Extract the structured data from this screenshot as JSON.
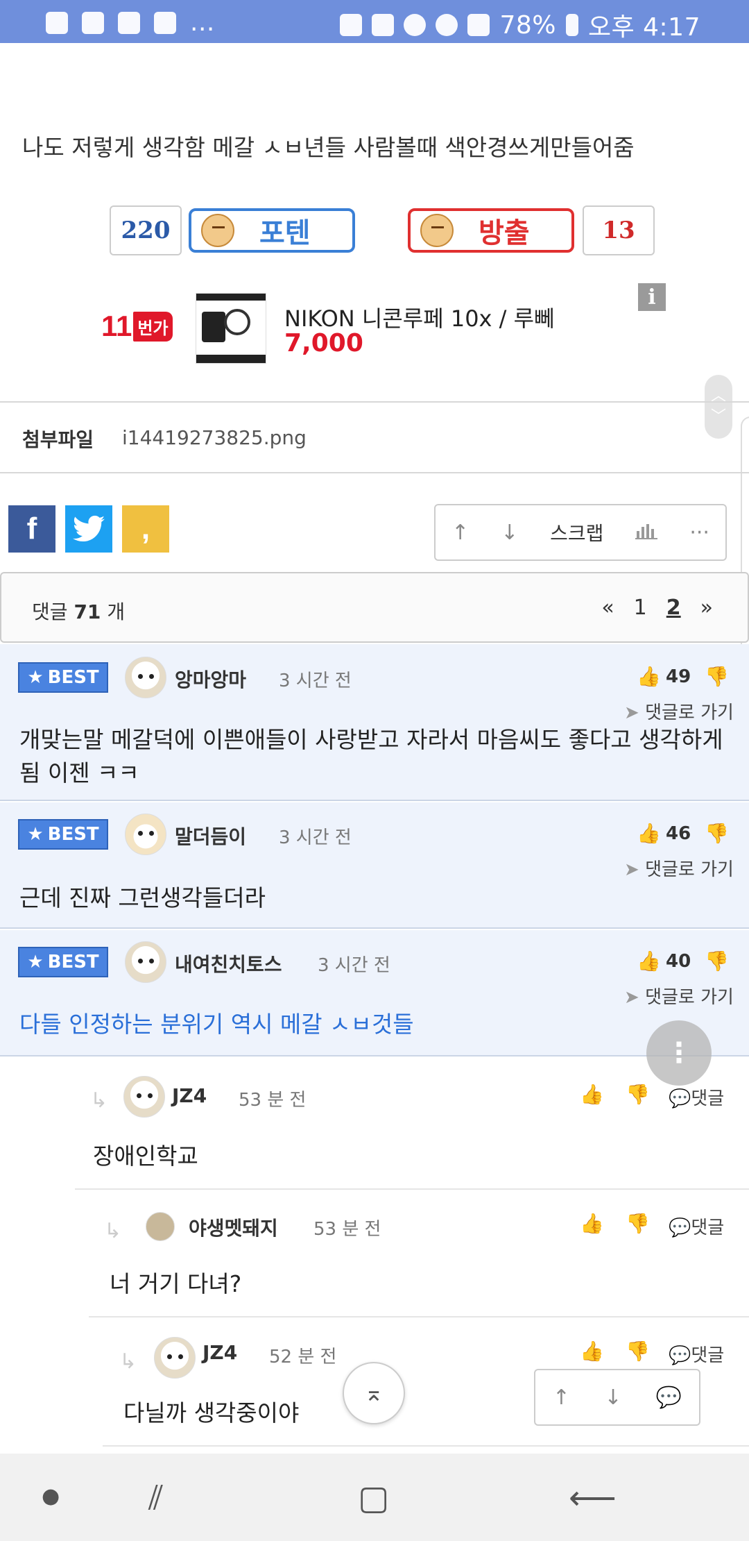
{
  "status_bar": {
    "battery": "78%",
    "time": "오후 4:17",
    "more": "..."
  },
  "post": {
    "text": "나도 저렇게 생각함 메갈 ㅅㅂ년들 사람볼때 색안경쓰게만들어줌"
  },
  "votes": {
    "potent_count": "220",
    "potent_label": "포텐",
    "release_label": "방출",
    "release_count": "13"
  },
  "ad": {
    "logo": "11",
    "logo_tag": "번가",
    "title": "NIKON 니콘루페 10x / 루뻬",
    "price": "7,000",
    "info": "i"
  },
  "attachment": {
    "label": "첨부파일",
    "file": "i14419273825.png"
  },
  "share": {
    "fb": "f",
    "ks": ","
  },
  "actions": {
    "up": "↑",
    "down": "↓",
    "scrap": "스크랩",
    "stats": "📊",
    "more": "···"
  },
  "comments_header": {
    "label": "댓글",
    "count": "71",
    "unit": "개",
    "pages": [
      "«",
      "1",
      "2",
      "»"
    ],
    "current_page": "2"
  },
  "best_label": "BEST",
  "goto_label": "댓글로 가기",
  "reply_label": "댓글",
  "best_comments": [
    {
      "nick": "앙마앙마",
      "time": "3 시간 전",
      "likes": "49",
      "text": "개맞는말 메갈덕에 이쁜애들이 사랑받고 자라서 마음씨도 좋다고 생각하게됨 이젠 ㅋㅋ"
    },
    {
      "nick": "말더듬이",
      "time": "3 시간 전",
      "likes": "46",
      "text": "근데 진짜 그런생각들더라"
    },
    {
      "nick": "내여친치토스",
      "time": "3 시간 전",
      "likes": "40",
      "text": "다들 인정하는 분위기 역시 메갈 ㅅㅂ것들"
    }
  ],
  "replies": [
    {
      "nick": "JZ4",
      "time": "53 분 전",
      "text": "장애인학교"
    },
    {
      "nick": "야생멧돼지",
      "time": "53 분 전",
      "text": "너 거기 다녀?"
    },
    {
      "nick": "JZ4",
      "time": "52 분 전",
      "text": "다닐까 생각중이야"
    }
  ],
  "colors": {
    "status_bar": "#6f8fdc",
    "potent": "#3a7fd6",
    "release": "#e03030",
    "best_bg": "#eef3fc",
    "badge": "#4a83e0",
    "price": "#e0182a"
  }
}
